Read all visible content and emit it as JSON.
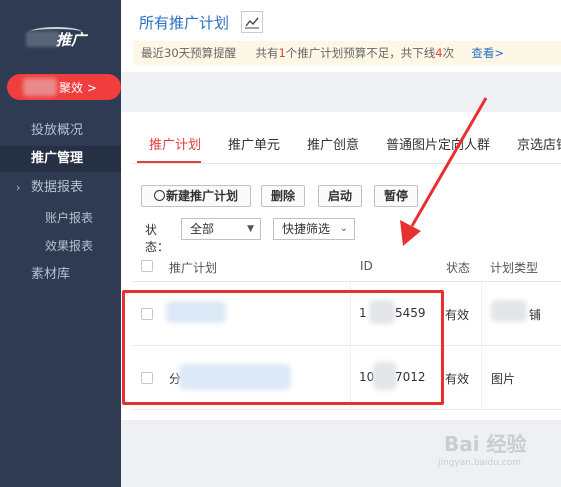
{
  "sidebar": {
    "logo_text": "推广",
    "badge_button": {
      "label": "聚效 >"
    },
    "items": [
      {
        "label": "投放概况",
        "active": false
      },
      {
        "label": "推广管理",
        "active": true
      },
      {
        "label": "数据报表",
        "active": false,
        "expandable": true
      },
      {
        "label": "账户报表",
        "active": false,
        "sub": true
      },
      {
        "label": "效果报表",
        "active": false,
        "sub": true
      },
      {
        "label": "素材库",
        "active": false
      }
    ]
  },
  "header": {
    "title": "所有推广计划"
  },
  "notice": {
    "prefix": "最近30天预算提醒",
    "text_1": "共有",
    "count_1": "1",
    "text_2": "个推广计划预算不足，共下线",
    "count_2": "4",
    "text_3": "次",
    "link": "查看>"
  },
  "tabs": [
    {
      "label": "推广计划",
      "active": true
    },
    {
      "label": "推广单元",
      "active": false
    },
    {
      "label": "推广创意",
      "active": false
    },
    {
      "label": "普通图片定向人群",
      "active": false
    },
    {
      "label": "京选店铺",
      "active": false
    }
  ],
  "toolbar": {
    "new_plan": "新建推广计划",
    "delete": "删除",
    "start": "启动",
    "pause": "暂停"
  },
  "filters": {
    "status_label": "状态：",
    "status_value": "全部",
    "quick_filter": "快捷筛选"
  },
  "table": {
    "columns": [
      "推广计划",
      "ID",
      "状态",
      "计划类型"
    ],
    "rows": [
      {
        "name": "",
        "id_prefix": "1",
        "id_suffix": "5459",
        "status": "有效",
        "type": "铺"
      },
      {
        "name": "分",
        "id_prefix": "10",
        "id_suffix": "7012",
        "status": "有效",
        "type": "图片"
      }
    ]
  },
  "watermark": {
    "brand": "Bai 经验",
    "url": "jingyan.baidu.com"
  },
  "colors": {
    "sidebar_bg": "#2e3b52",
    "accent_red": "#e43e3e",
    "link_blue": "#2b6fc4",
    "annotation_red": "#e8302f"
  }
}
